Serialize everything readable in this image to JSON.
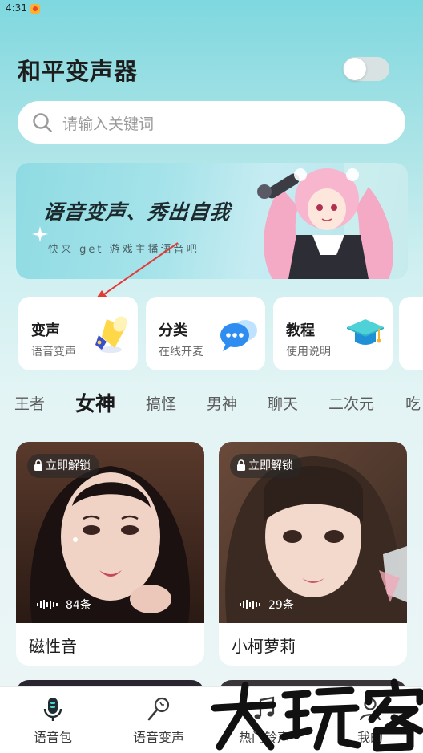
{
  "status": {
    "time": "4:31"
  },
  "header": {
    "title": "和平变声器"
  },
  "search": {
    "placeholder": "请输入关键词"
  },
  "banner": {
    "title": "语音变声、秀出自我",
    "subtitle": "快来 get 游戏主播语音吧"
  },
  "quick_cards": [
    {
      "title": "变声",
      "subtitle": "语音变声",
      "icon": "megaphone-icon"
    },
    {
      "title": "分类",
      "subtitle": "在线开麦",
      "icon": "chat-bubble-icon"
    },
    {
      "title": "教程",
      "subtitle": "使用说明",
      "icon": "graduation-cap-icon"
    }
  ],
  "category_tabs": {
    "items": [
      "王者",
      "女神",
      "搞怪",
      "男神",
      "聊天",
      "二次元",
      "吃"
    ],
    "active": "女神"
  },
  "voice_packs": [
    {
      "name": "磁性音",
      "count": "84条",
      "lock_label": "立即解锁"
    },
    {
      "name": "小柯萝莉",
      "count": "29条",
      "lock_label": "立即解锁"
    }
  ],
  "bottom_nav": [
    {
      "label": "语音包",
      "icon": "microphone-icon",
      "active": true
    },
    {
      "label": "语音变声",
      "icon": "magic-wand-icon"
    },
    {
      "label": "热门铃声",
      "icon": "music-note-icon"
    },
    {
      "label": "我的",
      "icon": "user-icon"
    }
  ],
  "watermark": {
    "text": "大玩家"
  },
  "colors": {
    "accent": "#2196f3",
    "arrow": "#e53935",
    "background_top": "#7ed8df"
  }
}
